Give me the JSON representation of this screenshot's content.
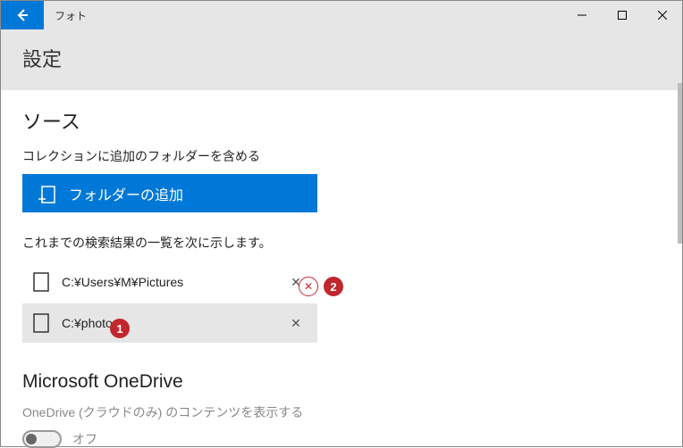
{
  "titlebar": {
    "app_name": "フォト"
  },
  "header": {
    "title": "設定"
  },
  "sources": {
    "title": "ソース",
    "subtitle": "コレクションに追加のフォルダーを含める",
    "add_button_label": "フォルダーの追加",
    "results_label": "これまでの検索結果の一覧を次に示します。",
    "folders": [
      {
        "path": "C:¥Users¥M¥Pictures",
        "selected": false
      },
      {
        "path": "C:¥photo",
        "selected": true
      }
    ]
  },
  "annotations": {
    "badge1": "1",
    "badge2": "2"
  },
  "onedrive": {
    "title": "Microsoft OneDrive",
    "subtitle": "OneDrive (クラウドのみ) のコンテンツを表示する",
    "toggle_state_label": "オフ"
  }
}
